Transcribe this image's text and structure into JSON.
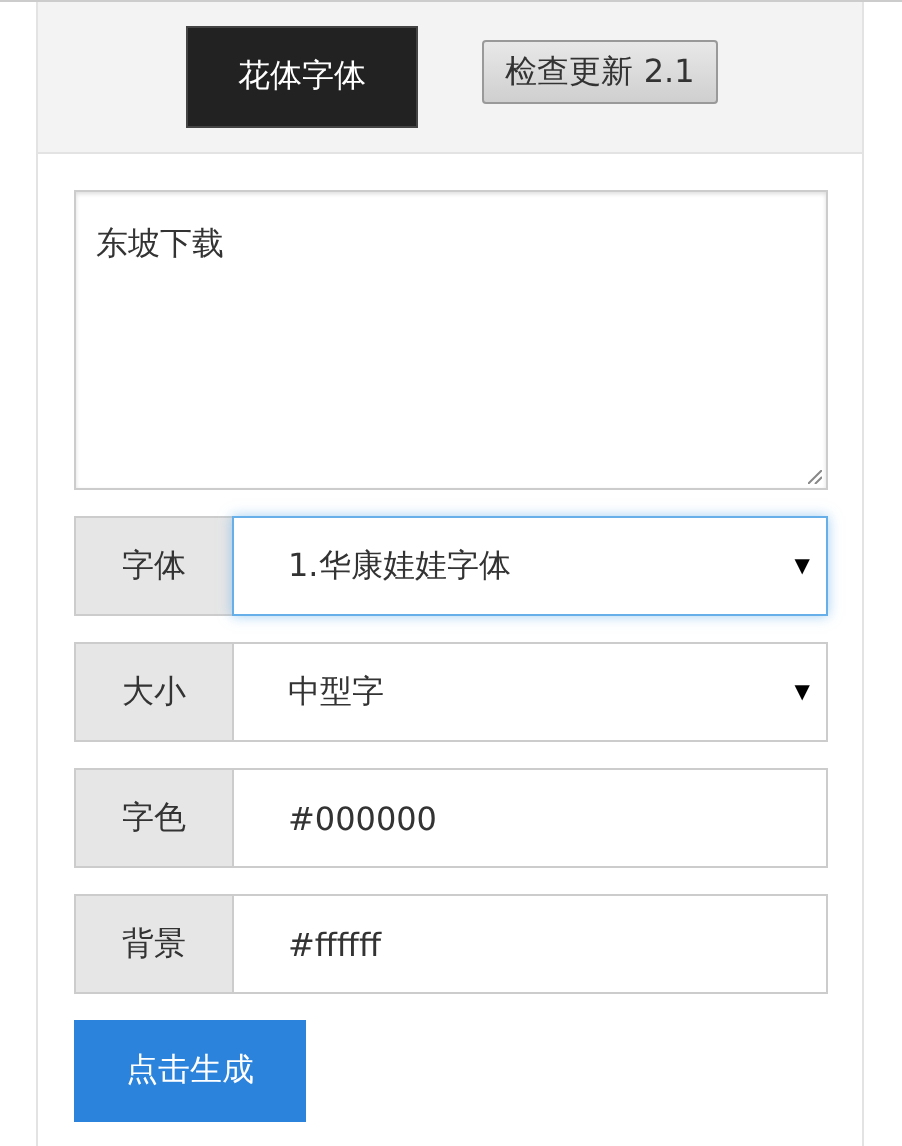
{
  "header": {
    "buttons": [
      {
        "label": "花体字体",
        "kind": "dark"
      },
      {
        "label": "检查更新 2.1",
        "kind": "plain"
      }
    ]
  },
  "text_input": {
    "value": "东坡下载"
  },
  "fields": [
    {
      "label": "字体",
      "kind": "select",
      "value": "1.华康娃娃字体",
      "arrow": "▼",
      "focused": true
    },
    {
      "label": "大小",
      "kind": "select",
      "value": "中型字",
      "arrow": "▼",
      "focused": false
    },
    {
      "label": "字色",
      "kind": "input",
      "value": "#000000",
      "focused": false
    },
    {
      "label": "背景",
      "kind": "input",
      "value": "#ffffff",
      "focused": false
    }
  ],
  "generate_button": {
    "label": "点击生成"
  }
}
